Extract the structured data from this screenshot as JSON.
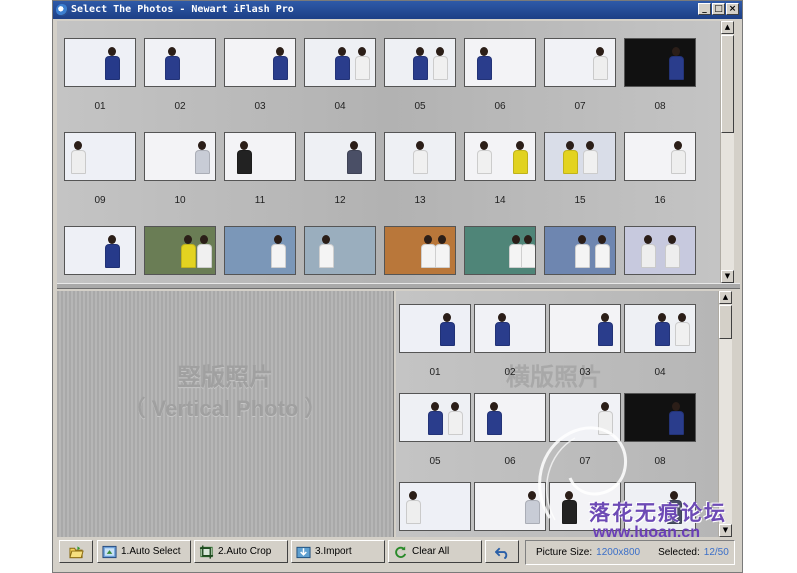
{
  "window": {
    "title": "Select The Photos - Newart iFlash Pro",
    "controls": [
      "_",
      "□",
      "×"
    ]
  },
  "top_grid": {
    "items": [
      {
        "label": "01",
        "bg": "#eef0f6",
        "figs": [
          {
            "c": "#263a8a",
            "x": 40
          }
        ]
      },
      {
        "label": "02",
        "bg": "#f1f2f6",
        "figs": [
          {
            "c": "#2a3d8c",
            "x": 20
          }
        ]
      },
      {
        "label": "03",
        "bg": "#f3f3f6",
        "figs": [
          {
            "c": "#2a3d8c",
            "x": 48
          }
        ]
      },
      {
        "label": "04",
        "bg": "#eef0f4",
        "figs": [
          {
            "c": "#2a3d8c",
            "x": 30
          },
          {
            "c": "#f0f0f0",
            "x": 50
          }
        ]
      },
      {
        "label": "05",
        "bg": "#eef0f4",
        "figs": [
          {
            "c": "#2a3d8c",
            "x": 28
          },
          {
            "c": "#f0f0f0",
            "x": 48
          }
        ]
      },
      {
        "label": "06",
        "bg": "#f3f3f6",
        "figs": [
          {
            "c": "#2a3d8c",
            "x": 12
          }
        ]
      },
      {
        "label": "07",
        "bg": "#f1f2f6",
        "figs": [
          {
            "c": "#eeeeee",
            "x": 48
          }
        ]
      },
      {
        "label": "08",
        "bg": "#111111",
        "figs": [
          {
            "c": "#2a3d8c",
            "x": 44
          }
        ]
      },
      {
        "label": "09",
        "bg": "#eef0f6",
        "figs": [
          {
            "c": "#eeeeee",
            "x": 6
          }
        ]
      },
      {
        "label": "10",
        "bg": "#f3f3f6",
        "figs": [
          {
            "c": "#c8ccd6",
            "x": 50
          }
        ]
      },
      {
        "label": "11",
        "bg": "#f3f3f6",
        "figs": [
          {
            "c": "#222222",
            "x": 12
          }
        ]
      },
      {
        "label": "12",
        "bg": "#eef0f4",
        "figs": [
          {
            "c": "#4a4f66",
            "x": 42
          }
        ]
      },
      {
        "label": "13",
        "bg": "#eef0f4",
        "figs": [
          {
            "c": "#f0f0f0",
            "x": 28
          }
        ]
      },
      {
        "label": "14",
        "bg": "#f3f3f6",
        "figs": [
          {
            "c": "#f0f0f0",
            "x": 12
          },
          {
            "c": "#e1d21f",
            "x": 48
          }
        ]
      },
      {
        "label": "15",
        "bg": "#d9dde8",
        "figs": [
          {
            "c": "#e3d320",
            "x": 18
          },
          {
            "c": "#f0f0f0",
            "x": 38
          }
        ]
      },
      {
        "label": "16",
        "bg": "#f3f3f6",
        "figs": [
          {
            "c": "#eeeeee",
            "x": 46
          }
        ]
      },
      {
        "label": "",
        "bg": "#eef0f6",
        "figs": [
          {
            "c": "#263a8a",
            "x": 40
          }
        ]
      },
      {
        "label": "",
        "bg": "#6a7d55",
        "figs": [
          {
            "c": "#e3d320",
            "x": 36
          },
          {
            "c": "#f0f0f0",
            "x": 52
          }
        ]
      },
      {
        "label": "",
        "bg": "#7b97b8",
        "figs": [
          {
            "c": "#f4f4f4",
            "x": 46
          }
        ]
      },
      {
        "label": "",
        "bg": "#9aaebe",
        "figs": [
          {
            "c": "#f4f4f4",
            "x": 14
          }
        ]
      },
      {
        "label": "",
        "bg": "#b9773a",
        "figs": [
          {
            "c": "#f4f4f4",
            "x": 36
          },
          {
            "c": "#f4f4f4",
            "x": 50
          }
        ]
      },
      {
        "label": "",
        "bg": "#4f8578",
        "figs": [
          {
            "c": "#f4f4f4",
            "x": 44
          },
          {
            "c": "#f4f4f4",
            "x": 56
          }
        ]
      },
      {
        "label": "",
        "bg": "#6e86b0",
        "figs": [
          {
            "c": "#f4f4f4",
            "x": 30
          },
          {
            "c": "#f4f4f4",
            "x": 50
          }
        ]
      },
      {
        "label": "",
        "bg": "#c7c9de",
        "figs": [
          {
            "c": "#eeeeee",
            "x": 16
          },
          {
            "c": "#eeeeee",
            "x": 40
          }
        ]
      }
    ]
  },
  "left_pane": {
    "title_cn": "竪版照片",
    "title_en": "（ Vertical Photo ）"
  },
  "right_pane": {
    "title_cn": "横版照片",
    "items": [
      {
        "label": "01",
        "bg": "#eef0f6",
        "figs": [
          {
            "c": "#263a8a",
            "x": 40
          }
        ]
      },
      {
        "label": "02",
        "bg": "#f1f2f6",
        "figs": [
          {
            "c": "#2a3d8c",
            "x": 20
          }
        ]
      },
      {
        "label": "03",
        "bg": "#f3f3f6",
        "figs": [
          {
            "c": "#2a3d8c",
            "x": 48
          }
        ]
      },
      {
        "label": "04",
        "bg": "#eef0f4",
        "figs": [
          {
            "c": "#2a3d8c",
            "x": 30
          },
          {
            "c": "#f0f0f0",
            "x": 50
          }
        ]
      },
      {
        "label": "05",
        "bg": "#eef0f4",
        "figs": [
          {
            "c": "#2a3d8c",
            "x": 28
          },
          {
            "c": "#f0f0f0",
            "x": 48
          }
        ]
      },
      {
        "label": "06",
        "bg": "#f3f3f6",
        "figs": [
          {
            "c": "#2a3d8c",
            "x": 12
          }
        ]
      },
      {
        "label": "07",
        "bg": "#f1f2f6",
        "figs": [
          {
            "c": "#eeeeee",
            "x": 48
          }
        ]
      },
      {
        "label": "08",
        "bg": "#111111",
        "figs": [
          {
            "c": "#2a3d8c",
            "x": 44
          }
        ]
      },
      {
        "label": "",
        "bg": "#eef0f6",
        "figs": [
          {
            "c": "#eeeeee",
            "x": 6
          }
        ]
      },
      {
        "label": "",
        "bg": "#f3f3f6",
        "figs": [
          {
            "c": "#c8ccd6",
            "x": 50
          }
        ]
      },
      {
        "label": "",
        "bg": "#f3f3f6",
        "figs": [
          {
            "c": "#222222",
            "x": 12
          }
        ]
      },
      {
        "label": "",
        "bg": "#eef0f4",
        "figs": [
          {
            "c": "#4a4f66",
            "x": 42
          }
        ]
      }
    ]
  },
  "toolbar": {
    "open_icon": "folder-open-icon",
    "auto_select": "1.Auto Select",
    "auto_crop": "2.Auto Crop",
    "import": "3.Import",
    "clear_all": "Clear All",
    "undo_icon": "undo-icon"
  },
  "status": {
    "picture_size_label": "Picture Size:",
    "picture_size_value": "1200x800",
    "selected_label": "Selected:",
    "selected_value": "12/50"
  },
  "watermark": {
    "logo": "落花无痕论坛",
    "url": "www.luoan.cn"
  },
  "colors": {
    "title_bar": "#1d3f86",
    "status_value": "#3b6fc8",
    "watermark": "#6d4ab5"
  }
}
